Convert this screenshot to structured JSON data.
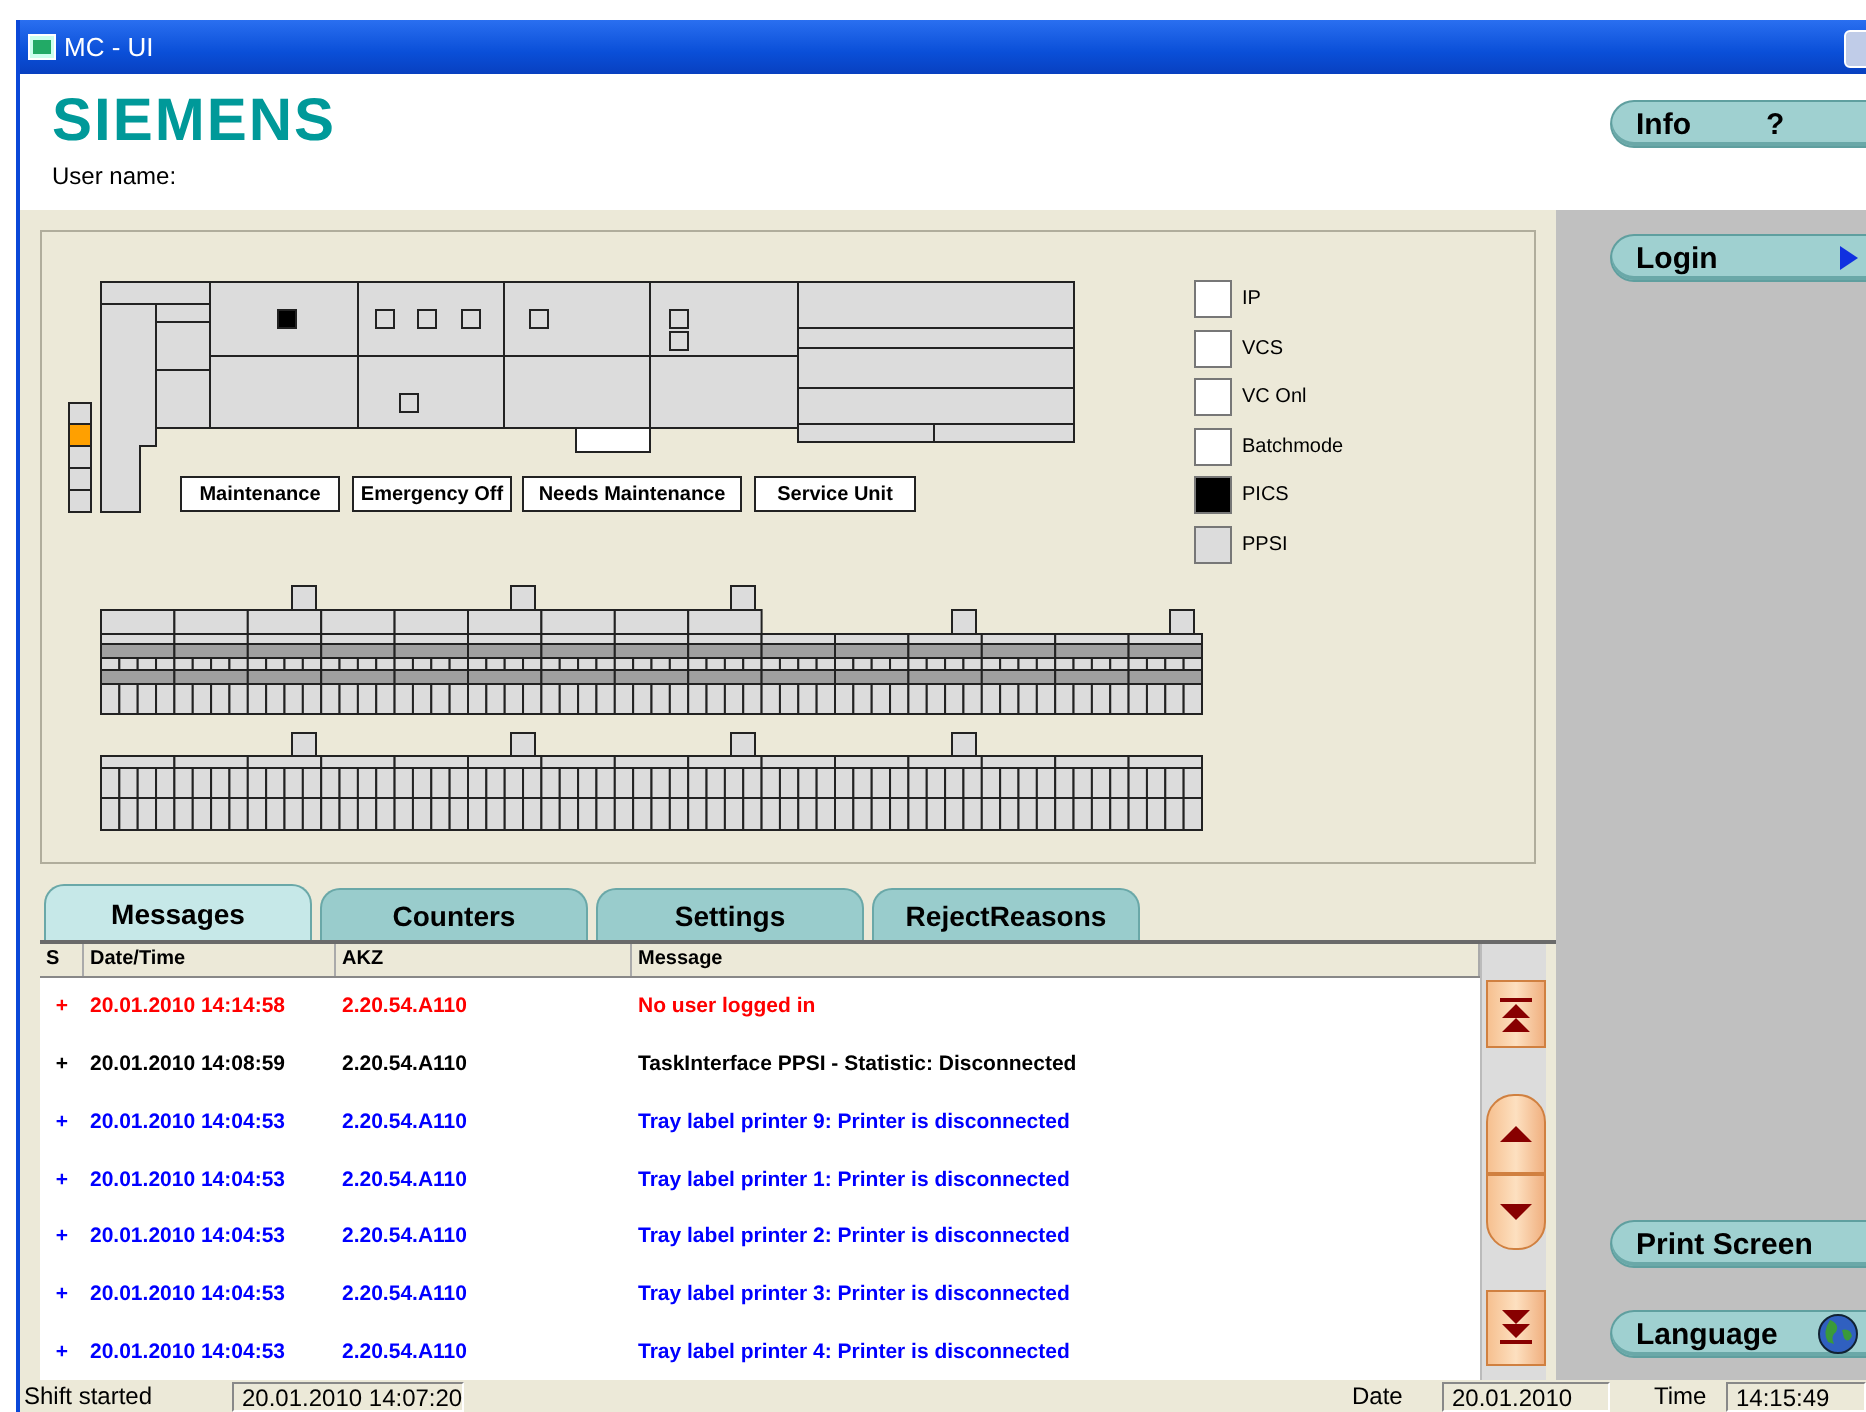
{
  "window": {
    "title": "MC - UI"
  },
  "header": {
    "logo": "SIEMENS",
    "user_label": "User name:"
  },
  "info_button": {
    "label": "Info",
    "icon": "?"
  },
  "machine": {
    "status_labels": [
      "Maintenance",
      "Emergency Off",
      "Needs Maintenance",
      "Service Unit"
    ],
    "legend": [
      {
        "label": "IP",
        "color": "#ffffff"
      },
      {
        "label": "VCS",
        "color": "#ffffff"
      },
      {
        "label": "VC Onl",
        "color": "#ffffff"
      },
      {
        "label": "Batchmode",
        "color": "#ffffff"
      },
      {
        "label": "PICS",
        "color": "#000000"
      },
      {
        "label": "PPSI",
        "color": "#dcdcdc"
      }
    ]
  },
  "tabs": [
    {
      "label": "Messages",
      "selected": true
    },
    {
      "label": "Counters",
      "selected": false
    },
    {
      "label": "Settings",
      "selected": false
    },
    {
      "label": "RejectReasons",
      "selected": false
    }
  ],
  "messages": {
    "columns": [
      "S",
      "Date/Time",
      "AKZ",
      "Message"
    ],
    "rows": [
      {
        "status": "+",
        "datetime": "20.01.2010 14:14:58",
        "akz": "2.20.54.A110",
        "message": "No user logged in",
        "color": "#ff0000"
      },
      {
        "status": "+",
        "datetime": "20.01.2010 14:08:59",
        "akz": "2.20.54.A110",
        "message": "TaskInterface PPSI - Statistic: Disconnected",
        "color": "#000000"
      },
      {
        "status": "+",
        "datetime": "20.01.2010 14:04:53",
        "akz": "2.20.54.A110",
        "message": "Tray label printer 9: Printer is disconnected",
        "color": "#0000ff"
      },
      {
        "status": "+",
        "datetime": "20.01.2010 14:04:53",
        "akz": "2.20.54.A110",
        "message": "Tray label printer 1: Printer is disconnected",
        "color": "#0000ff"
      },
      {
        "status": "+",
        "datetime": "20.01.2010 14:04:53",
        "akz": "2.20.54.A110",
        "message": "Tray label printer 2: Printer is disconnected",
        "color": "#0000ff"
      },
      {
        "status": "+",
        "datetime": "20.01.2010 14:04:53",
        "akz": "2.20.54.A110",
        "message": "Tray label printer 3: Printer is disconnected",
        "color": "#0000ff"
      },
      {
        "status": "+",
        "datetime": "20.01.2010 14:04:53",
        "akz": "2.20.54.A110",
        "message": "Tray label printer 4: Printer is disconnected",
        "color": "#0000ff"
      }
    ]
  },
  "sidebar": {
    "buttons": [
      {
        "label": "Login",
        "kind": "arrow"
      },
      {
        "label": "Print Screen",
        "kind": "plain"
      },
      {
        "label": "Language",
        "kind": "globe"
      }
    ]
  },
  "status_bar": {
    "shift_label": "Shift started",
    "shift_value": "20.01.2010 14:07:20",
    "date_label": "Date",
    "date_value": "20.01.2010",
    "time_label": "Time",
    "time_value": "14:15:49"
  }
}
